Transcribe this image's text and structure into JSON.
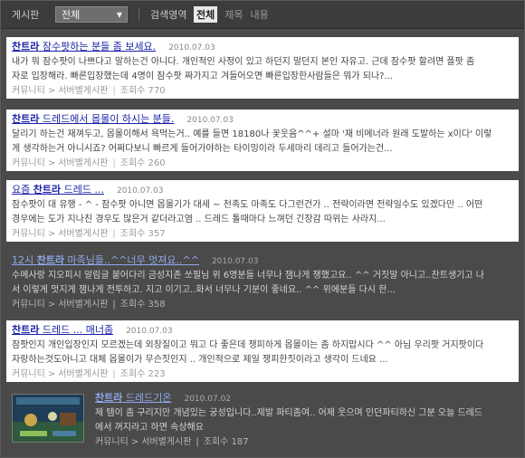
{
  "filterbar": {
    "board_label": "게시판",
    "board_select": "전체",
    "scope_label": "검색영역",
    "scope_options": [
      "전체",
      "제목",
      "내용"
    ],
    "scope_active": "전체"
  },
  "results": [
    {
      "title_parts": [
        "찬트라",
        " 잠수팟하는 분들 좀 보세요."
      ],
      "date": "2010.07.03",
      "snippet": [
        "내가 뭐 잠수팟이 나쁘다고 말하는건 아니다. 개인적인 사정이 있고 하던지 말던지 본인 자유고. 근데 잠수팟 할려면 플팟 좀",
        "자로 입장해라. 빠른입장했는데 4명이 잠수팟 짜가지고 겨들어오면 빠른입장한사람들은 뭐가 되나?..."
      ],
      "meta": {
        "community": "커뮤니티",
        "board": "서버별게시판",
        "views": "조회수 770"
      }
    },
    {
      "title_parts": [
        "찬트라",
        " 드레드에서 몹몰이 하시는 분들."
      ],
      "date": "2010.07.03",
      "snippet": [
        "달리기 하는건 재껴두고, 몹몰이해서 욕먹는거.. 예를 들면 18180나 꽃웃음^^+ 설마 '재 비메너라 원래 도발하는 x이다' 이렇",
        "게 생각하는거 아니시죠? 어쩌다보니 빠르게 들어가야하는 타이밍이라 두세마리 데리고 들어가는건..."
      ],
      "meta": {
        "community": "커뮤니티",
        "board": "서버별게시판",
        "views": "조회수 260"
      }
    },
    {
      "title_parts": [
        "요즘 ",
        "찬트라",
        " 드레드 ..."
      ],
      "date": "2010.07.03",
      "snippet": [
        "잠수팟이 대 유행 - ^ - 잠수팟 아니면 몹몰기가 대세 ~ 천족도 마족도 다그런건가 .. 전략이라면 전략일수도 있겠다만 .. 어떤",
        "경우에는 도가 지나친 경우도 많은거 같더라고염 .. 드레드 톨때마다 느껴던 긴장감 따위는 사라지..."
      ],
      "meta": {
        "community": "커뮤니티",
        "board": "서버별게시판",
        "views": "조회수 357"
      }
    },
    {
      "title_parts": [
        "12시 ",
        "찬트라",
        " 마족님들..^^너무 멋져요..^^"
      ],
      "date": "2010.07.03",
      "snippet": [
        "수메사랑 지오피시 알림글 붙어다리 금성지존 쏘필님 위 6명분들 너무나 잼나게 쟁했고요.. ^^ 거짓말 아니고..찬트생기고 나",
        "서 이렇게 멋지게 잼나게 전투하고. 지고 이기고..화서 너무나 기분이 좋네요.. ^^ 위에분들 다시 한..."
      ],
      "meta": {
        "community": "커뮤니티",
        "board": "서버별게시판",
        "views": "조회수 358"
      }
    },
    {
      "title_parts": [
        "찬트라",
        " 드레드 ... 매너좀"
      ],
      "date": "2010.07.03",
      "snippet": [
        "잠팟인지 개인입장인지 모르겠는데 외창질이고 뭐고 다 좋은데 쟁피하게 몹몰이는 좀 하지맙시다 ^^ 아님 우리팟 거지팟이다",
        "자랑하는것도아니고 대체 몹몰이가 무슨짓인지 .. 개인적으로 제일 쟁피한짓이라고 생각이 드네요 ..."
      ],
      "meta": {
        "community": "커뮤니티",
        "board": "서버별게시판",
        "views": "조회수 223"
      }
    },
    {
      "title_parts": [
        "찬트라",
        " 드레드기온"
      ],
      "date": "2010.07.02",
      "snippet": [
        "제 템이 좀 구리지만 개념있는 궁성입니다..제발 파티좀여.. 어제 웃으며 인던파티하신 그분 오늘 드레드",
        "에서 꺼지라고 하면 속상해요"
      ],
      "meta": {
        "community": "커뮤니티",
        "board": "서버별게시판",
        "views": "조회수 187"
      },
      "thumbnail": "game-screenshot-thumbnail"
    }
  ]
}
